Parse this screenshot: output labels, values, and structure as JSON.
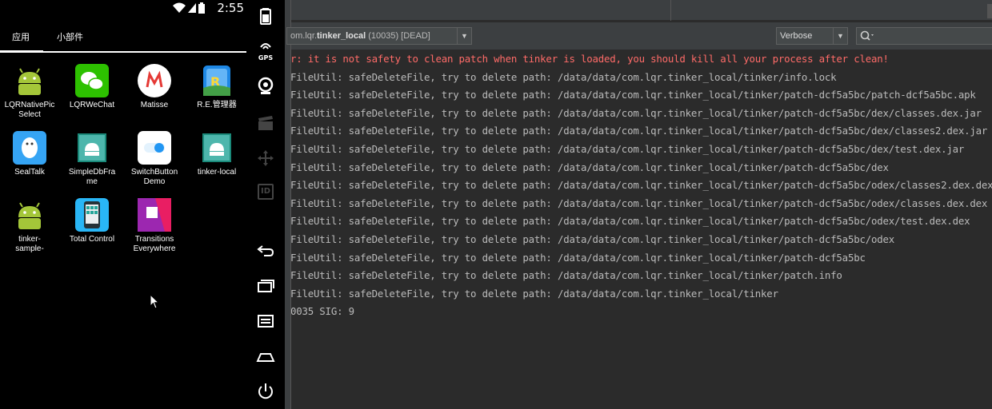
{
  "status_bar": {
    "time": "2:55"
  },
  "launcher": {
    "tabs": [
      {
        "label": "应用"
      },
      {
        "label": "小部件"
      }
    ],
    "apps": [
      {
        "label": "LQRNativePic\nSelect",
        "icon": "android-icon"
      },
      {
        "label": "LQRWeChat",
        "icon": "wechat-icon"
      },
      {
        "label": "Matisse",
        "icon": "matisse-icon"
      },
      {
        "label": "R.E.管理器",
        "icon": "re-manager-icon"
      },
      {
        "label": "SealTalk",
        "icon": "sealtalk-icon"
      },
      {
        "label": "SimpleDbFra\nme",
        "icon": "android-icon"
      },
      {
        "label": "SwitchButton\nDemo",
        "icon": "switch-icon"
      },
      {
        "label": "tinker-local",
        "icon": "android-icon"
      },
      {
        "label": "tinker-\nsample-",
        "icon": "android-icon"
      },
      {
        "label": "Total Control",
        "icon": "total-control-icon"
      },
      {
        "label": "Transitions\nEverywhere",
        "icon": "transitions-icon"
      }
    ]
  },
  "toolbar": {
    "items": [
      "battery-icon",
      "gps-icon",
      "camera-icon",
      "clapper-icon",
      "move-icon",
      "id-icon",
      "back-icon",
      "recents-icon",
      "menu-icon",
      "home-icon",
      "power-icon"
    ],
    "gps_label": "GPS",
    "id_label": "ID"
  },
  "logcat": {
    "process_prefix": "om.lqr.",
    "process_name": "tinker_local",
    "process_suffix": " (10035) [DEAD]",
    "log_level": "Verbose",
    "search_placeholder": "",
    "lines": [
      {
        "text": "r: it is not safety to clean patch when tinker is loaded, you should kill all your process after clean!",
        "level": "error"
      },
      {
        "text": "FileUtil: safeDeleteFile, try to delete path: /data/data/com.lqr.tinker_local/tinker/info.lock",
        "level": "info"
      },
      {
        "text": "FileUtil: safeDeleteFile, try to delete path: /data/data/com.lqr.tinker_local/tinker/patch-dcf5a5bc/patch-dcf5a5bc.apk",
        "level": "info"
      },
      {
        "text": "FileUtil: safeDeleteFile, try to delete path: /data/data/com.lqr.tinker_local/tinker/patch-dcf5a5bc/dex/classes.dex.jar",
        "level": "info"
      },
      {
        "text": "FileUtil: safeDeleteFile, try to delete path: /data/data/com.lqr.tinker_local/tinker/patch-dcf5a5bc/dex/classes2.dex.jar",
        "level": "info"
      },
      {
        "text": "FileUtil: safeDeleteFile, try to delete path: /data/data/com.lqr.tinker_local/tinker/patch-dcf5a5bc/dex/test.dex.jar",
        "level": "info"
      },
      {
        "text": "FileUtil: safeDeleteFile, try to delete path: /data/data/com.lqr.tinker_local/tinker/patch-dcf5a5bc/dex",
        "level": "info"
      },
      {
        "text": "FileUtil: safeDeleteFile, try to delete path: /data/data/com.lqr.tinker_local/tinker/patch-dcf5a5bc/odex/classes2.dex.dex",
        "level": "info"
      },
      {
        "text": "FileUtil: safeDeleteFile, try to delete path: /data/data/com.lqr.tinker_local/tinker/patch-dcf5a5bc/odex/classes.dex.dex",
        "level": "info"
      },
      {
        "text": "FileUtil: safeDeleteFile, try to delete path: /data/data/com.lqr.tinker_local/tinker/patch-dcf5a5bc/odex/test.dex.dex",
        "level": "info"
      },
      {
        "text": "FileUtil: safeDeleteFile, try to delete path: /data/data/com.lqr.tinker_local/tinker/patch-dcf5a5bc/odex",
        "level": "info"
      },
      {
        "text": "FileUtil: safeDeleteFile, try to delete path: /data/data/com.lqr.tinker_local/tinker/patch-dcf5a5bc",
        "level": "info"
      },
      {
        "text": "FileUtil: safeDeleteFile, try to delete path: /data/data/com.lqr.tinker_local/tinker/patch.info",
        "level": "info"
      },
      {
        "text": "FileUtil: safeDeleteFile, try to delete path: /data/data/com.lqr.tinker_local/tinker",
        "level": "info"
      },
      {
        "text": "0035 SIG: 9",
        "level": "info"
      }
    ]
  },
  "colors": {
    "error": "#ff6b68",
    "info": "#bbbbbb",
    "panel": "#2b2b2b"
  }
}
